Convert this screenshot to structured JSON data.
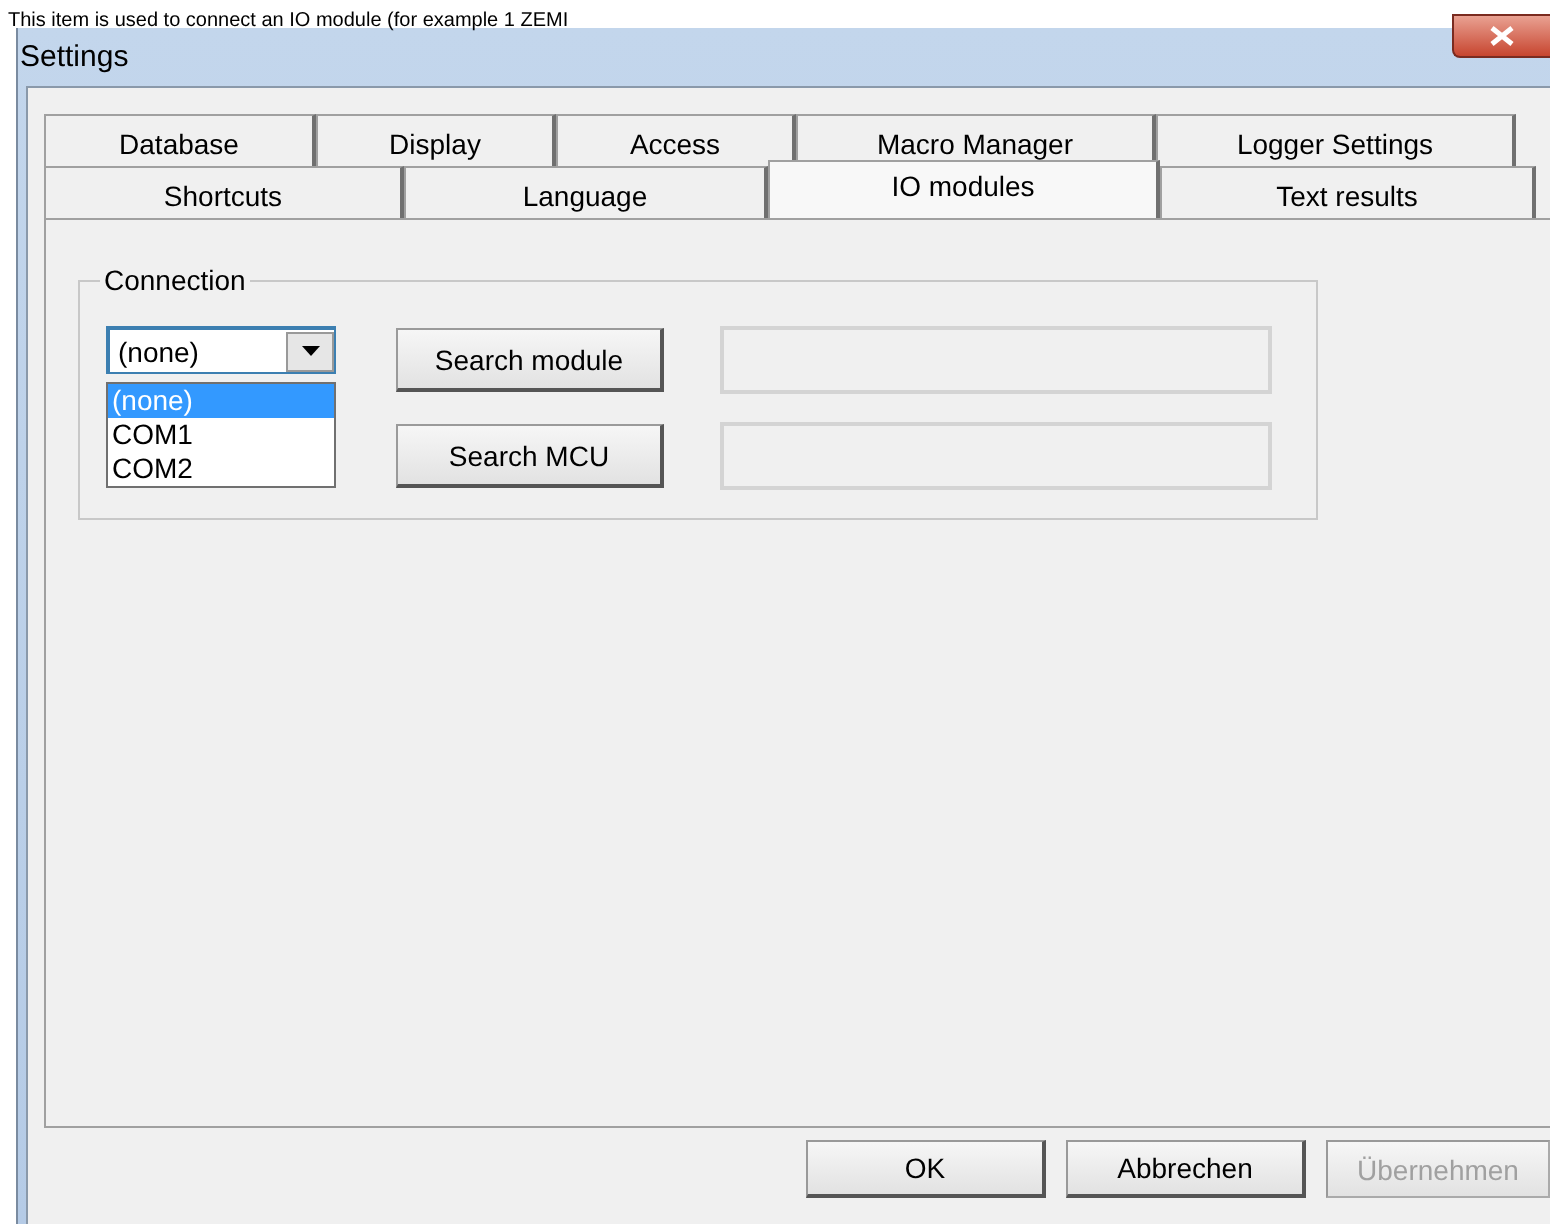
{
  "caption": "This item is used to connect an IO module (for example 1 ZEMI",
  "window": {
    "title": "Settings"
  },
  "tab_rows": [
    [
      {
        "label": "Database",
        "selected": false
      },
      {
        "label": "Display",
        "selected": false
      },
      {
        "label": "Access",
        "selected": false
      },
      {
        "label": "Macro Manager",
        "selected": false
      },
      {
        "label": "Logger Settings",
        "selected": false
      }
    ],
    [
      {
        "label": "Shortcuts",
        "selected": false
      },
      {
        "label": "Language",
        "selected": false
      },
      {
        "label": "IO modules",
        "selected": true
      },
      {
        "label": "Text results",
        "selected": false
      }
    ]
  ],
  "connection": {
    "title": "Connection",
    "port": {
      "value": "(none)",
      "expanded": true,
      "options": [
        {
          "label": "(none)",
          "selected": true
        },
        {
          "label": "COM1",
          "selected": false
        },
        {
          "label": "COM2",
          "selected": false
        }
      ]
    },
    "rows": [
      {
        "button": "Search module"
      },
      {
        "button": "Search MCU"
      }
    ]
  },
  "buttons": [
    {
      "label": "OK",
      "disabled": false
    },
    {
      "label": "Abbrechen",
      "disabled": false
    },
    {
      "label": "Übernehmen",
      "disabled": true
    }
  ]
}
